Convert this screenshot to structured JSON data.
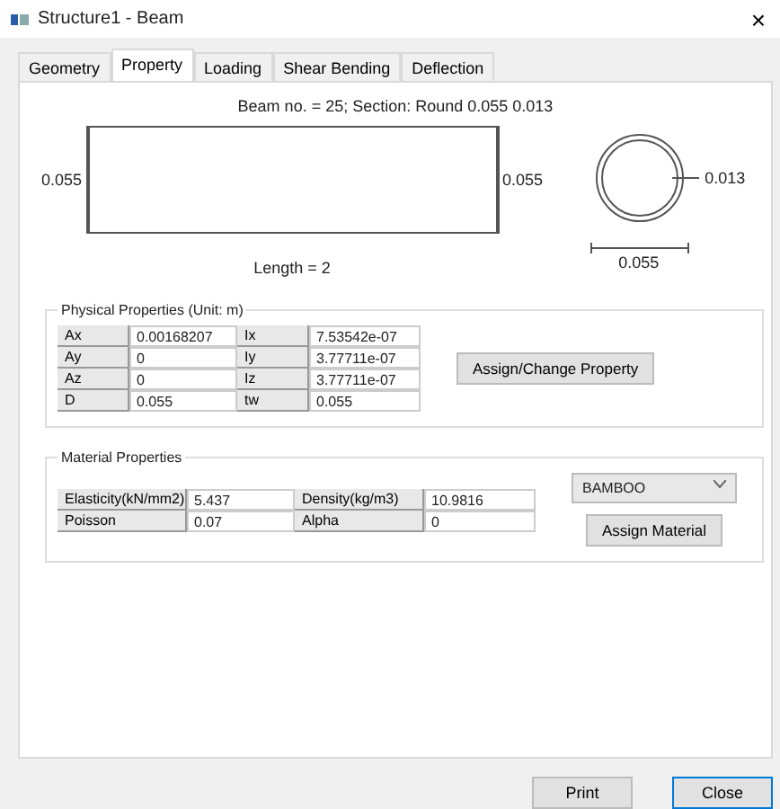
{
  "window": {
    "title": "Structure1 - Beam",
    "close": "×"
  },
  "tabs": [
    {
      "label": "Geometry",
      "selected": false
    },
    {
      "label": "Property",
      "selected": true
    },
    {
      "label": "Loading",
      "selected": false
    },
    {
      "label": "Shear Bending",
      "selected": false
    },
    {
      "label": "Deflection",
      "selected": false
    }
  ],
  "beam": {
    "header": "Beam no. = 25; Section: Round 0.055 0.013",
    "left_dim": "0.055",
    "right_dim": "0.055",
    "length": "Length = 2",
    "thickness": "0.013",
    "diameter": "0.055"
  },
  "physical": {
    "title": "Physical Properties (Unit: m)",
    "rows": [
      {
        "label": "Ax",
        "value": "0.00168207",
        "label2": "Ix",
        "value2": "7.53542e-07"
      },
      {
        "label": "Ay",
        "value": "0",
        "label2": "Iy",
        "value2": "3.77711e-07"
      },
      {
        "label": "Az",
        "value": "0",
        "label2": "Iz",
        "value2": "3.77711e-07"
      },
      {
        "label": "D",
        "value": "0.055",
        "label2": "tw",
        "value2": "0.055"
      }
    ],
    "button": "Assign/Change Property"
  },
  "material": {
    "title": "Material Properties",
    "rows": [
      {
        "label": "Elasticity(kN/mm2)",
        "value": "5.437",
        "label2": "Density(kg/m3)",
        "value2": "10.9816"
      },
      {
        "label": "Poisson",
        "value": "0.07",
        "label2": "Alpha",
        "value2": "0"
      }
    ],
    "select": "BAMBOO",
    "button": "Assign Material"
  },
  "buttons": [
    "Print",
    "Close"
  ]
}
